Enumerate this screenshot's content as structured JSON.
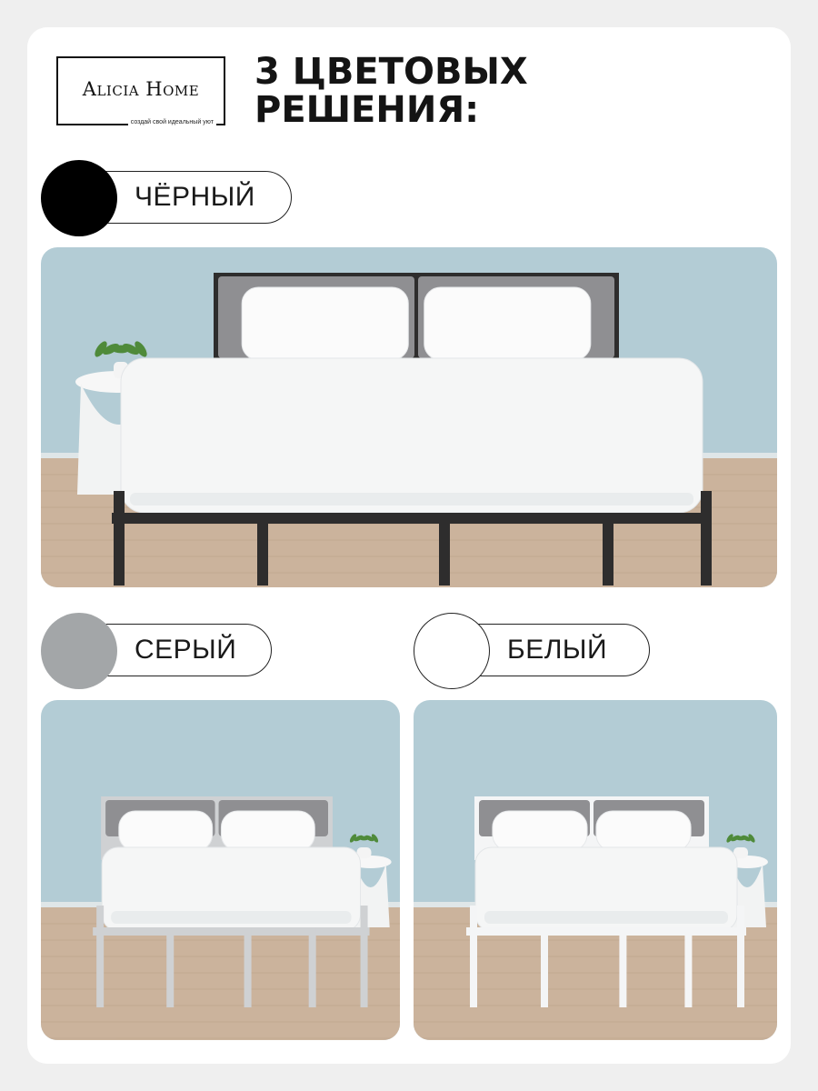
{
  "brand": {
    "name": "Alicia Home",
    "tagline": "создай свой идеальный уют"
  },
  "headline": {
    "line1": "3 ЦВЕТОВЫХ",
    "line2": "РЕШЕНИЯ:"
  },
  "colors": [
    {
      "label": "ЧЁРНЫЙ",
      "swatch": "#000000",
      "frame": "#2e2d2d"
    },
    {
      "label": "СЕРЫЙ",
      "swatch": "#a3a6a8",
      "frame": "#cfd1d3"
    },
    {
      "label": "БЕЛЫЙ",
      "swatch": "#ffffff",
      "frame": "#f4f5f6"
    }
  ],
  "scene": {
    "wall": "#b3ccd5",
    "floor": "#cbb39c",
    "headboard": "#8f8f92",
    "linen": "#f5f6f6"
  }
}
